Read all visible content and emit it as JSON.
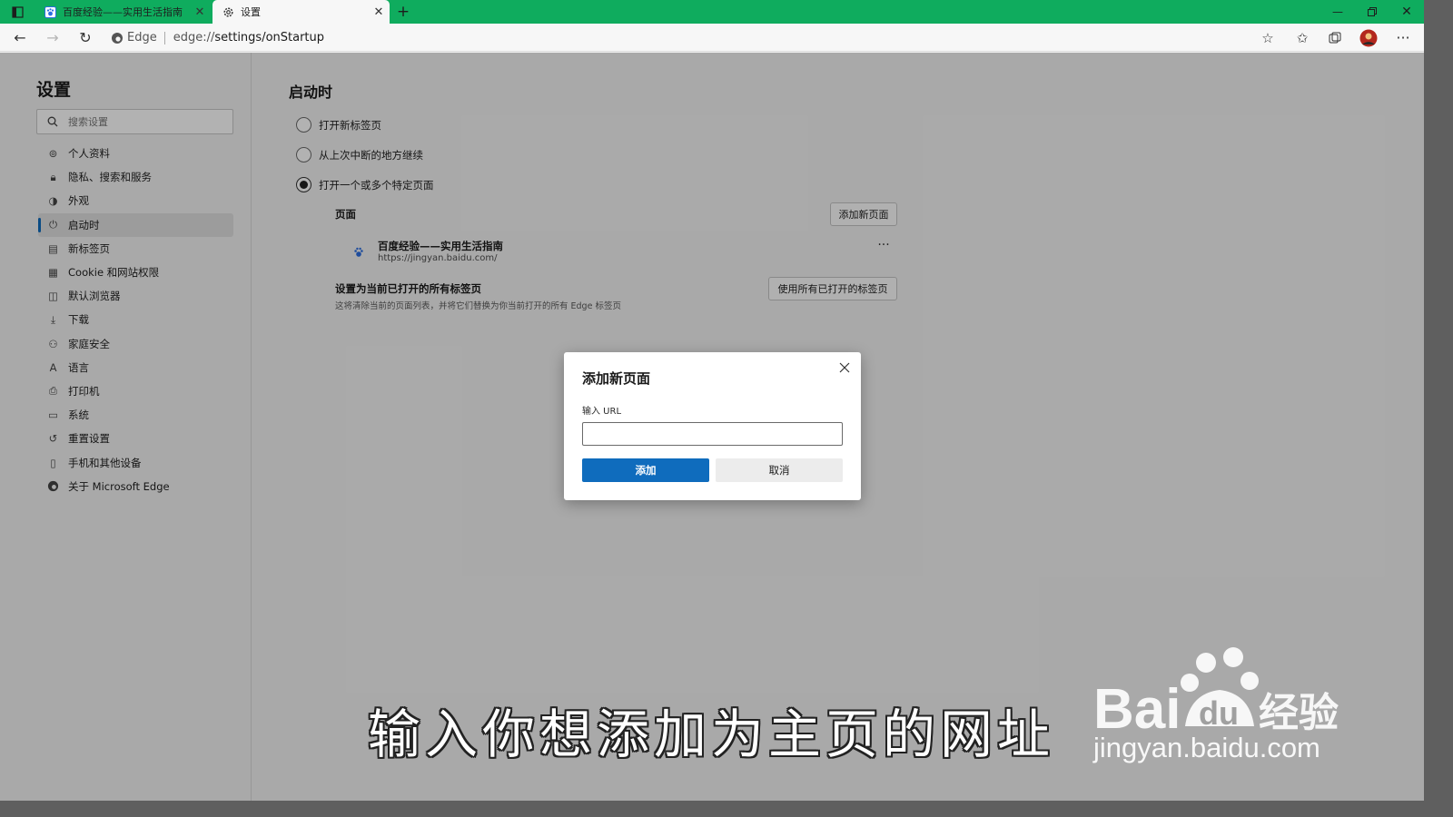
{
  "tabs": [
    {
      "title": "百度经验——实用生活指南",
      "active": false
    },
    {
      "title": "设置",
      "active": true
    }
  ],
  "address": {
    "browser_label": "Edge",
    "url_prefix": "edge://",
    "url_main": "settings/onStartup"
  },
  "sidebar": {
    "title": "设置",
    "search_placeholder": "搜索设置",
    "items": [
      {
        "label": "个人资料",
        "icon": "profile-icon"
      },
      {
        "label": "隐私、搜索和服务",
        "icon": "lock-icon"
      },
      {
        "label": "外观",
        "icon": "appearance-icon"
      },
      {
        "label": "启动时",
        "icon": "power-icon",
        "active": true
      },
      {
        "label": "新标签页",
        "icon": "new-tab-icon"
      },
      {
        "label": "Cookie 和网站权限",
        "icon": "cookie-icon"
      },
      {
        "label": "默认浏览器",
        "icon": "default-browser-icon"
      },
      {
        "label": "下载",
        "icon": "download-icon"
      },
      {
        "label": "家庭安全",
        "icon": "family-icon"
      },
      {
        "label": "语言",
        "icon": "language-icon"
      },
      {
        "label": "打印机",
        "icon": "printer-icon"
      },
      {
        "label": "系统",
        "icon": "system-icon"
      },
      {
        "label": "重置设置",
        "icon": "reset-icon"
      },
      {
        "label": "手机和其他设备",
        "icon": "phone-icon"
      },
      {
        "label": "关于 Microsoft Edge",
        "icon": "edge-logo-icon"
      }
    ]
  },
  "startup": {
    "heading": "启动时",
    "options": [
      {
        "label": "打开新标签页",
        "selected": false
      },
      {
        "label": "从上次中断的地方继续",
        "selected": false
      },
      {
        "label": "打开一个或多个特定页面",
        "selected": true
      }
    ],
    "pages_label": "页面",
    "add_page_button": "添加新页面",
    "page_entry": {
      "title": "百度经验——实用生活指南",
      "url": "https://jingyan.baidu.com/"
    },
    "more_label": "···",
    "set_all_title": "设置为当前已打开的所有标签页",
    "set_all_desc": "这将清除当前的页面列表，并将它们替换为你当前打开的所有 Edge 标签页",
    "use_all_button": "使用所有已打开的标签页"
  },
  "dialog": {
    "title": "添加新页面",
    "label": "输入 URL",
    "input_value": "",
    "add_button": "添加",
    "cancel_button": "取消"
  },
  "caption": "输入你想添加为主页的网址",
  "watermark": {
    "brand": "Baidu经验",
    "url": "jingyan.baidu.com"
  },
  "colors": {
    "tabbar": "#0fac5e",
    "accent": "#0f6cbd"
  }
}
